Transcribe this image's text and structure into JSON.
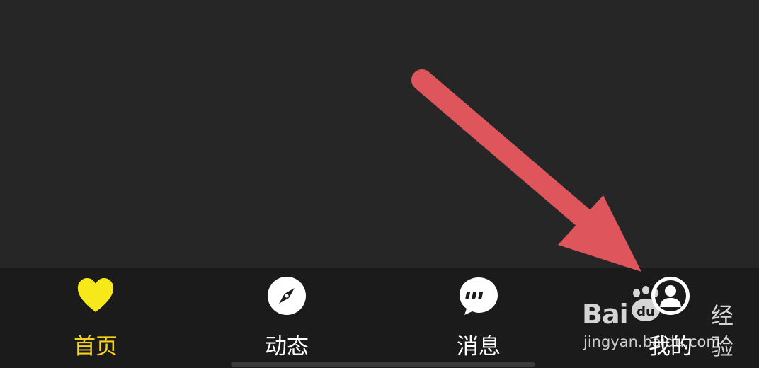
{
  "colors": {
    "background": "#262626",
    "tab_bar": "#1b1b1b",
    "active": "#f7d21f",
    "inactive_text": "#ffffff",
    "arrow": "#de555c"
  },
  "tabs": [
    {
      "label": "首页",
      "icon": "heart-icon",
      "active": true
    },
    {
      "label": "动态",
      "icon": "compass-icon",
      "active": false
    },
    {
      "label": "消息",
      "icon": "chat-bubble-icon",
      "active": false
    },
    {
      "label": "我的",
      "icon": "person-icon",
      "active": false
    }
  ],
  "watermark": {
    "logo_text_left": "Bai",
    "logo_text_right": "经验",
    "paw_text": "du",
    "url": "jingyan.baidu.com"
  }
}
